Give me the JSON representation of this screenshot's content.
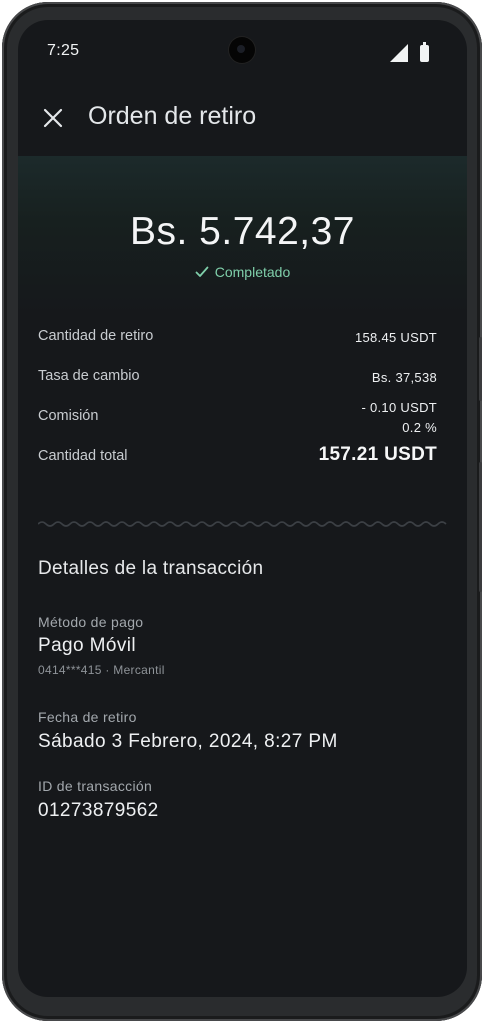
{
  "status_bar": {
    "time": "7:25",
    "signal_icon": "cell-signal-icon",
    "battery_icon": "battery-icon"
  },
  "app_bar": {
    "close_icon": "close-icon",
    "title": "Orden de retiro"
  },
  "summary": {
    "amount": "Bs. 5.742,37",
    "status": "Completado",
    "status_icon": "check-icon",
    "status_color": "#7fcfaa"
  },
  "breakdown": {
    "withdraw_label": "Cantidad de retiro",
    "withdraw_value": "158.45 USDT",
    "rate_label": "Tasa de cambio",
    "rate_value": "Bs. 37,538",
    "fee_label": "Comisión",
    "fee_value": "- 0.10 USDT",
    "fee_percent": "0.2 %",
    "total_label": "Cantidad total",
    "total_value": "157.21 USDT"
  },
  "details": {
    "section_title": "Detalles de la transacción",
    "method_label": "Método de pago",
    "method_value": "Pago Móvil",
    "method_sub": "0414***415 · Mercantil",
    "date_label": "Fecha de retiro",
    "date_value": "Sábado 3 Febrero, 2024, 8:27 PM",
    "id_label": "ID de transacción",
    "id_value": "01273879562"
  },
  "colors": {
    "background": "#16181b",
    "accent": "#7fcfaa"
  }
}
